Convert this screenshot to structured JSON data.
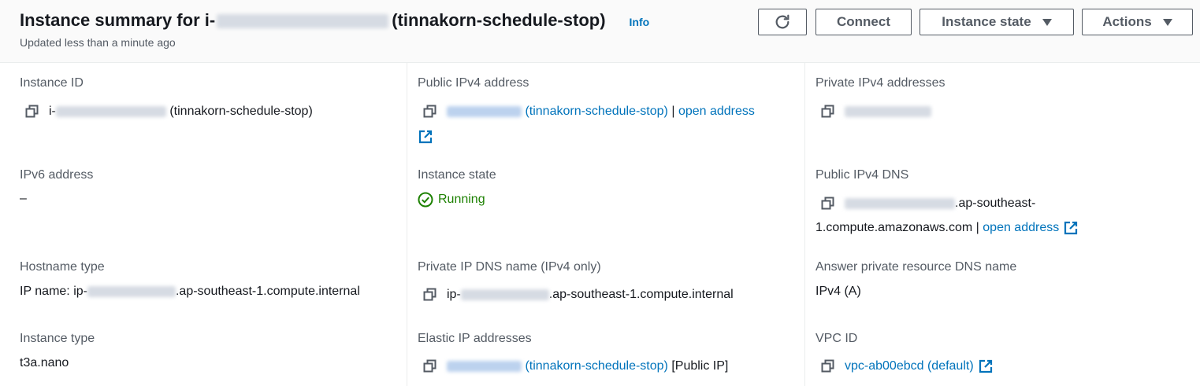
{
  "header": {
    "title_prefix": "Instance summary for i-",
    "title_suffix": "(tinnakorn-schedule-stop)",
    "info_label": "Info",
    "subtitle": "Updated less than a minute ago",
    "buttons": {
      "refresh_icon": "refresh-icon",
      "connect": "Connect",
      "instance_state": "Instance state",
      "actions": "Actions"
    }
  },
  "details": {
    "instance_id": {
      "label": "Instance ID",
      "prefix": "i-",
      "suffix": "(tinnakorn-schedule-stop)"
    },
    "public_ipv4": {
      "label": "Public IPv4 address",
      "name": "(tinnakorn-schedule-stop)",
      "separator": "|",
      "open_label": "open address"
    },
    "private_ipv4": {
      "label": "Private IPv4 addresses"
    },
    "ipv6": {
      "label": "IPv6 address",
      "value": "–"
    },
    "instance_state": {
      "label": "Instance state",
      "value": "Running"
    },
    "public_dns": {
      "label": "Public IPv4 DNS",
      "line1_suffix": ".ap-southeast-",
      "line2": "1.compute.amazonaws.com",
      "separator": "|",
      "open_label": "open address"
    },
    "hostname_type": {
      "label": "Hostname type",
      "prefix": "IP name: ip-",
      "suffix": ".ap-southeast-1.compute.internal"
    },
    "private_dns": {
      "label": "Private IP DNS name (IPv4 only)",
      "prefix": "ip-",
      "suffix": ".ap-southeast-1.compute.internal"
    },
    "answer_dns": {
      "label": "Answer private resource DNS name",
      "value": "IPv4 (A)"
    },
    "instance_type": {
      "label": "Instance type",
      "value": "t3a.nano"
    },
    "elastic_ip": {
      "label": "Elastic IP addresses",
      "name": "(tinnakorn-schedule-stop)",
      "tag": "[Public IP]"
    },
    "vpc_id": {
      "label": "VPC ID",
      "value": "vpc-ab00ebcd (default)"
    }
  },
  "colors": {
    "link": "#0073bb",
    "success": "#1d8102",
    "label": "#545b64"
  }
}
